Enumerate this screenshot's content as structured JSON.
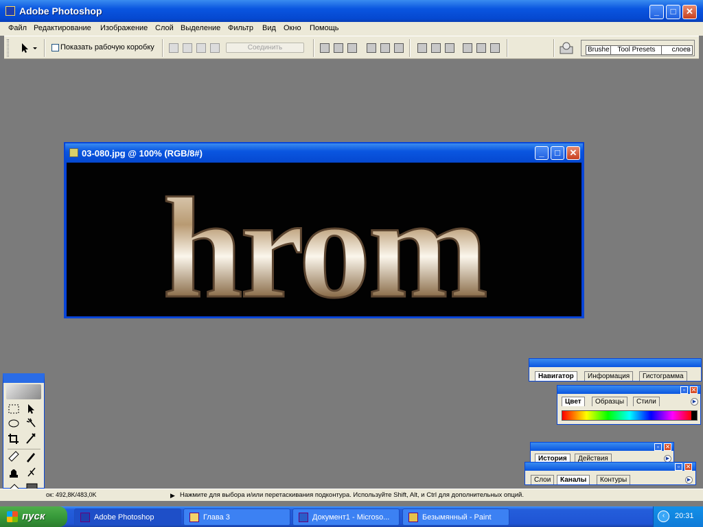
{
  "window": {
    "title": "Adobe Photoshop",
    "controls": {
      "minimize": "_",
      "maximize": "□",
      "close": "✕"
    }
  },
  "menubar": {
    "items": [
      "Файл",
      "Редактирование",
      "Изображение",
      "Слой",
      "Выделение",
      "Фильтр",
      "Вид",
      "Окно",
      "Помощь"
    ]
  },
  "options": {
    "show_bounding_box_label": "Показать рабочую коробку",
    "connect_label": "Соединить",
    "palette_well_tabs": [
      "Brushe",
      "Tool Presets",
      "слоев"
    ]
  },
  "document": {
    "title": "03-080.jpg @ 100% (RGB/8#)",
    "image_text": "hrom"
  },
  "palettes": {
    "navigator_group": {
      "tabs": [
        "Навигатор",
        "Информация",
        "Гистограмма"
      ]
    },
    "color_group": {
      "tabs": [
        "Цвет",
        "Образцы",
        "Стили"
      ]
    },
    "history_group": {
      "tabs": [
        "История",
        "Действия"
      ]
    },
    "layers_group": {
      "tabs": [
        "Слои",
        "Каналы",
        "Контуры"
      ]
    }
  },
  "status": {
    "doc_size": "ок: 492,8K/483,0K",
    "hint": "Нажмите для выбора и/или перетаскивания подконтура.  Используйте Shift, Alt, и Ctrl для дополнительных опций."
  },
  "taskbar": {
    "start_label": "пуск",
    "tasks": [
      "Adobe Photoshop",
      "Глава 3",
      "Документ1 - Microso...",
      "Безымянный - Paint"
    ],
    "clock": "20:31"
  },
  "colors": {
    "xp_blue": "#0a56e0",
    "start_green": "#379a3a",
    "workspace_gray": "#7b7b7b",
    "chrome_gold": "#c9b28a"
  }
}
